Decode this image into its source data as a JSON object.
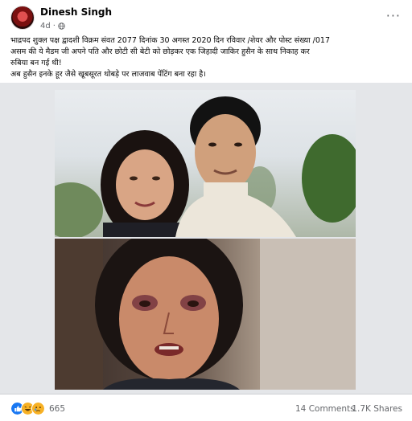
{
  "post": {
    "author": "Dinesh Singh",
    "time": "4d",
    "privacy_icon": "globe-icon",
    "more_icon": "more-options-icon",
    "more_label": "···",
    "caption_lines": [
      "भाद्रपद शुक्ल पक्ष द्वादशी विक्रम संवत 2077 दिनांक 30 अगस्त 2020 दिन रविवार /शेयर और पोस्ट संख्या /017",
      "असम की ये मैडम जी अपने पति और छोटी सी बेटी को छोड़कर एक जिहादी जाकिर हुसैन के साथ निकाह कर",
      "रुबिया बन गई थी!",
      "अब हुसैन इनके हूर जैसे खूबसूरत थोबड़े पर लाजवाब पेंटिंग बना रहा है।"
    ]
  },
  "footer": {
    "reaction_icons": [
      "like-icon",
      "haha-icon",
      "sad-icon"
    ],
    "reaction_count": "665",
    "comments": "14 Comments",
    "shares": "1.7K Shares"
  },
  "colors": {
    "like": "#1877f2",
    "haha": "#f7b125",
    "secondary_text": "#65676b",
    "divider": "#ced0d4"
  }
}
